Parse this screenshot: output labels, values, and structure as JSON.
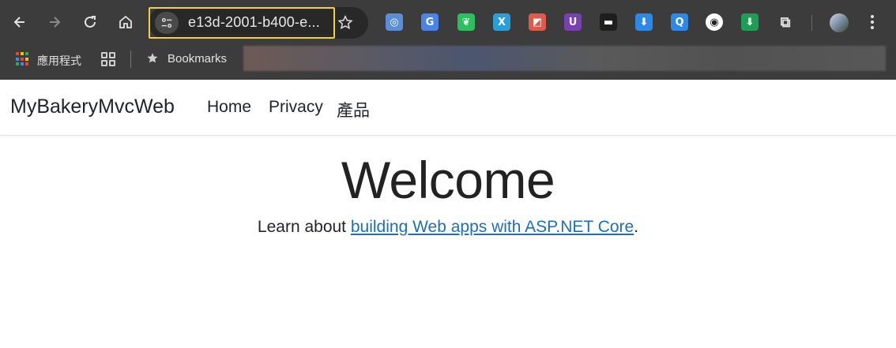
{
  "browser": {
    "url": "e13d-2001-b400-e...",
    "bookmarks_bar": {
      "apps_label": "應用程式",
      "bookmarks_label": "Bookmarks"
    },
    "extensions": [
      {
        "name": "opera-icon",
        "glyph": "◎",
        "color": "#5a8fd6"
      },
      {
        "name": "google-translate-icon",
        "glyph": "G",
        "color": "#4a84e8"
      },
      {
        "name": "evernote-icon",
        "glyph": "❦",
        "color": "#2dbe60"
      },
      {
        "name": "x-extension-icon",
        "glyph": "X",
        "color": "#2a9fd6"
      },
      {
        "name": "color-extension-icon",
        "glyph": "◩",
        "color": "#e05a4c"
      },
      {
        "name": "u-extension-icon",
        "glyph": "U",
        "color": "#7b3fb5"
      },
      {
        "name": "terminal-extension-icon",
        "glyph": "▬",
        "color": "#1e1e1e"
      },
      {
        "name": "file-download-icon",
        "glyph": "⬇",
        "color": "#2d88e8"
      },
      {
        "name": "q-extension-icon",
        "glyph": "Q",
        "color": "#2d88e8"
      },
      {
        "name": "spy-extension-icon",
        "glyph": "◉",
        "color": "#ffffff"
      },
      {
        "name": "green-download-icon",
        "glyph": "⬇",
        "color": "#1e9e55"
      },
      {
        "name": "puzzle-icon",
        "glyph": "⧉",
        "color": "#3c3c3c"
      }
    ]
  },
  "page": {
    "brand": "MyBakeryMvcWeb",
    "nav": [
      "Home",
      "Privacy",
      "產品"
    ],
    "heading": "Welcome",
    "learn_prefix": "Learn about ",
    "learn_link": "building Web apps with ASP.NET Core",
    "learn_suffix": "."
  },
  "colors": {
    "link": "#1b6ec2",
    "highlight": "#f2d23c",
    "chrome_bg": "#3c3c3c"
  }
}
